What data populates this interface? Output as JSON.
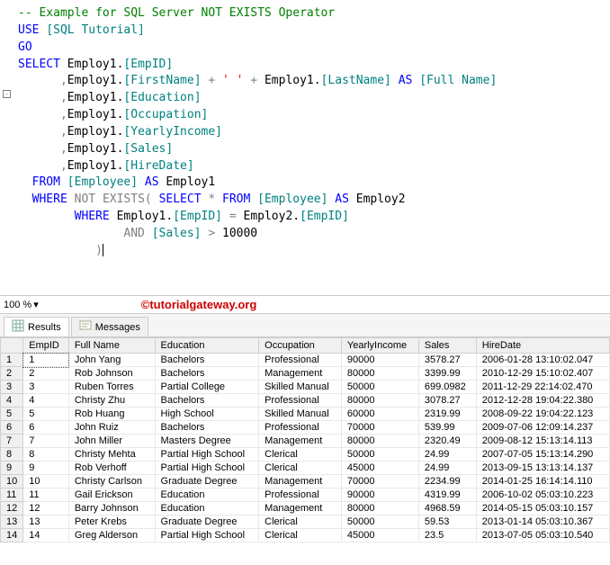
{
  "sql": {
    "comment": "-- Example for SQL Server NOT EXISTS Operator",
    "use": "USE",
    "useArg": "[SQL Tutorial]",
    "go": "GO",
    "select": "SELECT",
    "l1a": "Employ1.",
    "l1b": "[EmpID]",
    "l2a": "Employ1.",
    "l2b": "[FirstName]",
    "l2c": " + ",
    "l2d": "' '",
    "l2e": " + ",
    "l2f": "Employ1.",
    "l2g": "[LastName]",
    "l2h": "AS",
    "l2i": "[Full Name]",
    "l3a": "Employ1.",
    "l3b": "[Education]",
    "l4a": "Employ1.",
    "l4b": "[Occupation]",
    "l5a": "Employ1.",
    "l5b": "[YearlyIncome]",
    "l6a": "Employ1.",
    "l6b": "[Sales]",
    "l7a": "Employ1.",
    "l7b": "[HireDate]",
    "from": "FROM",
    "fromArg": "[Employee]",
    "as": "AS",
    "fromAlias": " Employ1",
    "where": "WHERE",
    "not": "NOT",
    "exists": "EXISTS",
    "sel2": "SELECT",
    "star": " * ",
    "from2": "FROM",
    "from2Arg": "[Employee]",
    "from2Alias": " Employ2",
    "where2": "WHERE",
    "w2a": " Employ1.",
    "w2b": "[EmpID]",
    "w2c": " = ",
    "w2d": "Employ2.",
    "w2e": "[EmpID]",
    "and": "AND",
    "salesCol": "[Sales]",
    "gt": " > ",
    "tenk": "10000",
    "paren": ")"
  },
  "zoom": "100 %",
  "watermark": "©tutorialgateway.org",
  "tabs": {
    "results": "Results",
    "messages": "Messages"
  },
  "columns": [
    "EmpID",
    "Full Name",
    "Education",
    "Occupation",
    "YearlyIncome",
    "Sales",
    "HireDate"
  ],
  "rows": [
    [
      "1",
      "John Yang",
      "Bachelors",
      "Professional",
      "90000",
      "3578.27",
      "2006-01-28 13:10:02.047"
    ],
    [
      "2",
      "Rob Johnson",
      "Bachelors",
      "Management",
      "80000",
      "3399.99",
      "2010-12-29 15:10:02.407"
    ],
    [
      "3",
      "Ruben Torres",
      "Partial College",
      "Skilled Manual",
      "50000",
      "699.0982",
      "2011-12-29 22:14:02.470"
    ],
    [
      "4",
      "Christy Zhu",
      "Bachelors",
      "Professional",
      "80000",
      "3078.27",
      "2012-12-28 19:04:22.380"
    ],
    [
      "5",
      "Rob Huang",
      "High School",
      "Skilled Manual",
      "60000",
      "2319.99",
      "2008-09-22 19:04:22.123"
    ],
    [
      "6",
      "John Ruiz",
      "Bachelors",
      "Professional",
      "70000",
      "539.99",
      "2009-07-06 12:09:14.237"
    ],
    [
      "7",
      "John Miller",
      "Masters Degree",
      "Management",
      "80000",
      "2320.49",
      "2009-08-12 15:13:14.113"
    ],
    [
      "8",
      "Christy Mehta",
      "Partial High School",
      "Clerical",
      "50000",
      "24.99",
      "2007-07-05 15:13:14.290"
    ],
    [
      "9",
      "Rob Verhoff",
      "Partial High School",
      "Clerical",
      "45000",
      "24.99",
      "2013-09-15 13:13:14.137"
    ],
    [
      "10",
      "Christy Carlson",
      "Graduate Degree",
      "Management",
      "70000",
      "2234.99",
      "2014-01-25 16:14:14.110"
    ],
    [
      "11",
      "Gail Erickson",
      "Education",
      "Professional",
      "90000",
      "4319.99",
      "2006-10-02 05:03:10.223"
    ],
    [
      "12",
      "Barry Johnson",
      "Education",
      "Management",
      "80000",
      "4968.59",
      "2014-05-15 05:03:10.157"
    ],
    [
      "13",
      "Peter Krebs",
      "Graduate Degree",
      "Clerical",
      "50000",
      "59.53",
      "2013-01-14 05:03:10.367"
    ],
    [
      "14",
      "Greg Alderson",
      "Partial High School",
      "Clerical",
      "45000",
      "23.5",
      "2013-07-05 05:03:10.540"
    ]
  ]
}
